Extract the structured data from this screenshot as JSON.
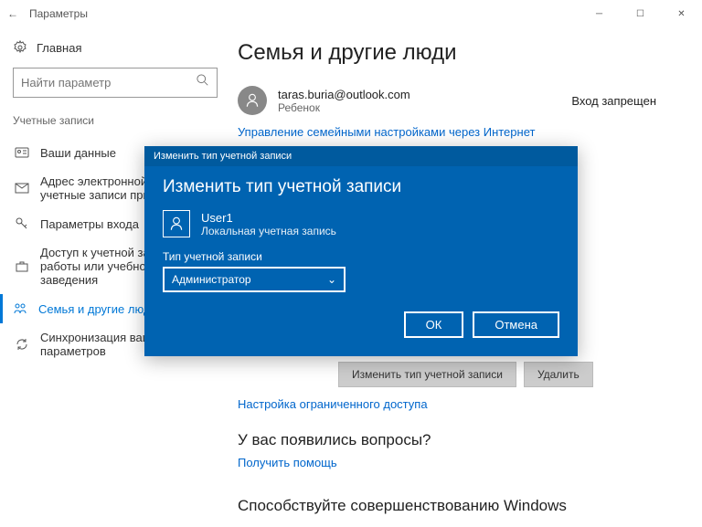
{
  "window": {
    "title": "Параметры",
    "back_icon": "←"
  },
  "sidebar": {
    "home": "Главная",
    "search_placeholder": "Найти параметр",
    "section": "Учетные записи",
    "items": [
      {
        "label": "Ваши данные"
      },
      {
        "label": "Адрес электронной почты; учетные записи приложений"
      },
      {
        "label": "Параметры входа"
      },
      {
        "label": "Доступ к учетной записи места работы или учебного заведения"
      },
      {
        "label": "Семья и другие люди"
      },
      {
        "label": "Синхронизация ваших параметров"
      }
    ]
  },
  "main": {
    "title": "Семья и другие люди",
    "family_user": {
      "email": "taras.buria@outlook.com",
      "role": "Ребенок",
      "status": "Вход запрещен"
    },
    "manage_link": "Управление семейными настройками через Интернет",
    "change_btn": "Изменить тип учетной записи",
    "delete_btn": "Удалить",
    "restricted_link": "Настройка ограниченного доступа",
    "questions_h": "У вас появились вопросы?",
    "help_link": "Получить помощь",
    "improve_h": "Способствуйте совершенствованию Windows"
  },
  "modal": {
    "title": "Изменить тип учетной записи",
    "heading": "Изменить тип учетной записи",
    "user_name": "User1",
    "user_sub": "Локальная учетная запись",
    "type_label": "Тип учетной записи",
    "selected": "Администратор",
    "ok": "ОК",
    "cancel": "Отмена"
  }
}
